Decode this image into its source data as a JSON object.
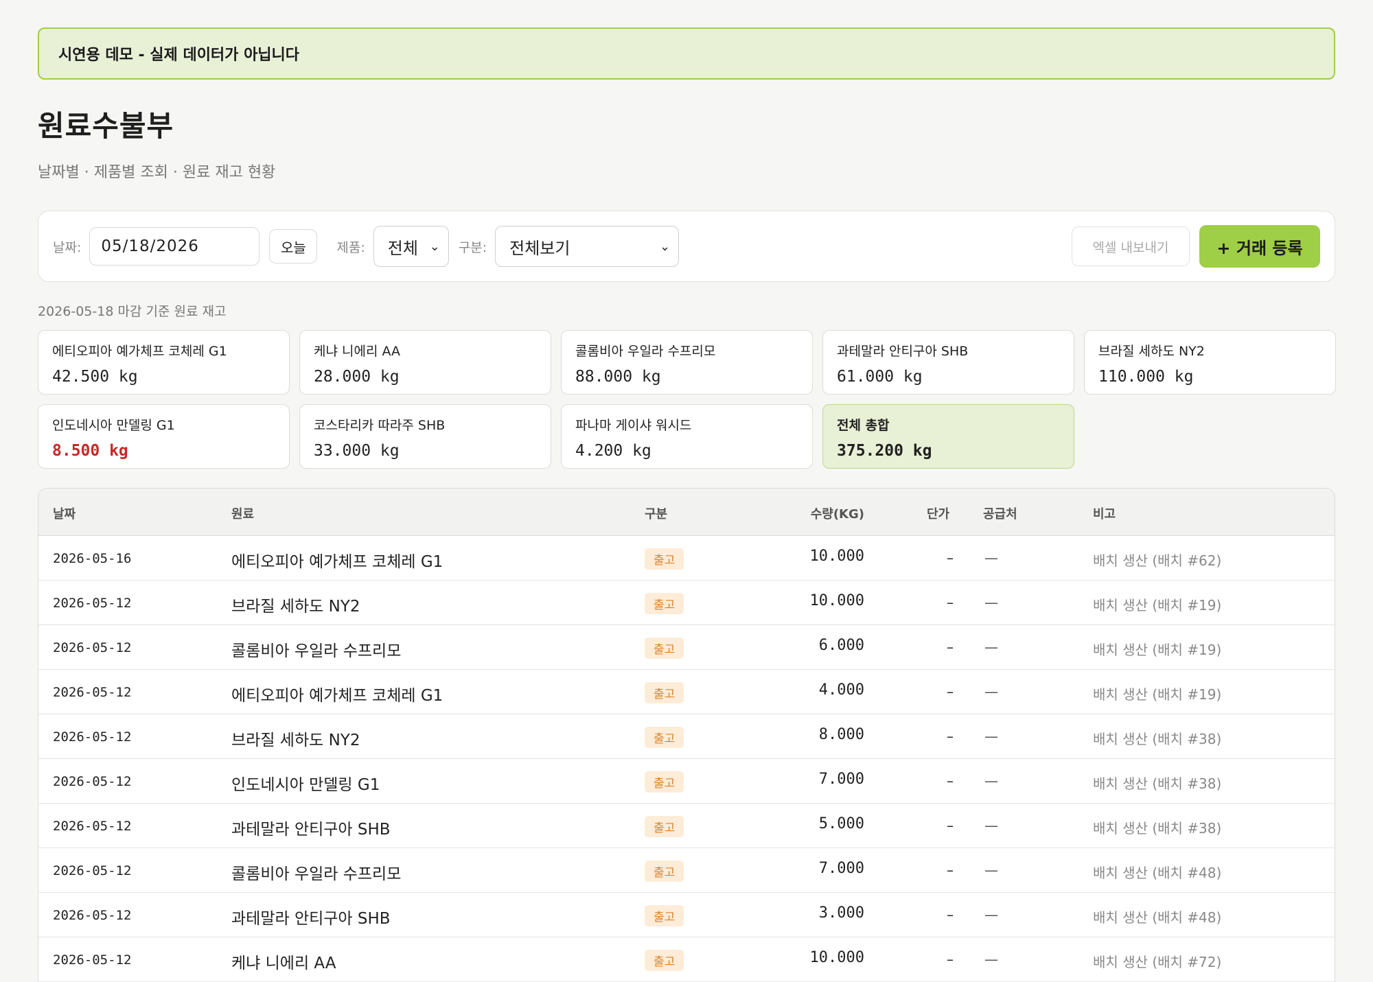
{
  "banner": {
    "text": "시연용 데모 - 실제 데이터가 아닙니다"
  },
  "header": {
    "title": "원료수불부",
    "subtitle": "날짜별 · 제품별 조회 · 원료 재고 현황"
  },
  "toolbar": {
    "date_label": "날짜:",
    "date_value": "05/18/2026",
    "today_label": "오늘",
    "product_label": "제품:",
    "product_value": "전체",
    "type_label": "구분:",
    "type_value": "전체보기",
    "export_label": "엑셀 내보내기",
    "register_label": "+ 거래 등록"
  },
  "stock": {
    "caption": "2026-05-18 마감 기준 원료 재고",
    "cards": [
      {
        "name": "에티오피아 예가체프 코체레 G1",
        "qty": "42.500 kg"
      },
      {
        "name": "케냐 니에리 AA",
        "qty": "28.000 kg"
      },
      {
        "name": "콜롬비아 우일라 수프리모",
        "qty": "88.000 kg"
      },
      {
        "name": "과테말라 안티구아 SHB",
        "qty": "61.000 kg"
      },
      {
        "name": "브라질 세하도 NY2",
        "qty": "110.000 kg"
      },
      {
        "name": "인도네시아 만델링 G1",
        "qty": "8.500 kg"
      },
      {
        "name": "코스타리카 따라주 SHB",
        "qty": "33.000 kg"
      },
      {
        "name": "파나마 게이샤 워시드",
        "qty": "4.200 kg"
      }
    ],
    "total": {
      "name": "전체 총합",
      "qty": "375.200 kg"
    },
    "low_stock_color": "#c62828"
  },
  "table": {
    "headers": {
      "date": "날짜",
      "material": "원료",
      "type": "구분",
      "qty": "수량(KG)",
      "price": "단가",
      "supplier": "공급처",
      "note": "비고"
    },
    "rows": [
      {
        "date": "2026-05-16",
        "material": "에티오피아 예가체프 코체레 G1",
        "type": "출고",
        "qty": "10.000",
        "price": "–",
        "supplier": "—",
        "note": "배치 생산 (배치 #62)"
      },
      {
        "date": "2026-05-12",
        "material": "브라질 세하도 NY2",
        "type": "출고",
        "qty": "10.000",
        "price": "–",
        "supplier": "—",
        "note": "배치 생산 (배치 #19)"
      },
      {
        "date": "2026-05-12",
        "material": "콜롬비아 우일라 수프리모",
        "type": "출고",
        "qty": "6.000",
        "price": "–",
        "supplier": "—",
        "note": "배치 생산 (배치 #19)"
      },
      {
        "date": "2026-05-12",
        "material": "에티오피아 예가체프 코체레 G1",
        "type": "출고",
        "qty": "4.000",
        "price": "–",
        "supplier": "—",
        "note": "배치 생산 (배치 #19)"
      },
      {
        "date": "2026-05-12",
        "material": "브라질 세하도 NY2",
        "type": "출고",
        "qty": "8.000",
        "price": "–",
        "supplier": "—",
        "note": "배치 생산 (배치 #38)"
      },
      {
        "date": "2026-05-12",
        "material": "인도네시아 만델링 G1",
        "type": "출고",
        "qty": "7.000",
        "price": "–",
        "supplier": "—",
        "note": "배치 생산 (배치 #38)"
      },
      {
        "date": "2026-05-12",
        "material": "과테말라 안티구아 SHB",
        "type": "출고",
        "qty": "5.000",
        "price": "–",
        "supplier": "—",
        "note": "배치 생산 (배치 #38)"
      },
      {
        "date": "2026-05-12",
        "material": "콜롬비아 우일라 수프리모",
        "type": "출고",
        "qty": "7.000",
        "price": "–",
        "supplier": "—",
        "note": "배치 생산 (배치 #48)"
      },
      {
        "date": "2026-05-12",
        "material": "과테말라 안티구아 SHB",
        "type": "출고",
        "qty": "3.000",
        "price": "–",
        "supplier": "—",
        "note": "배치 생산 (배치 #48)"
      },
      {
        "date": "2026-05-12",
        "material": "케냐 니에리 AA",
        "type": "출고",
        "qty": "10.000",
        "price": "–",
        "supplier": "—",
        "note": "배치 생산 (배치 #72)"
      }
    ]
  },
  "colors": {
    "accent": "#9fce47",
    "banner_bg": "#e8f0d6",
    "badge_out_bg": "#fdecd8",
    "badge_out_text": "#d9822b"
  }
}
